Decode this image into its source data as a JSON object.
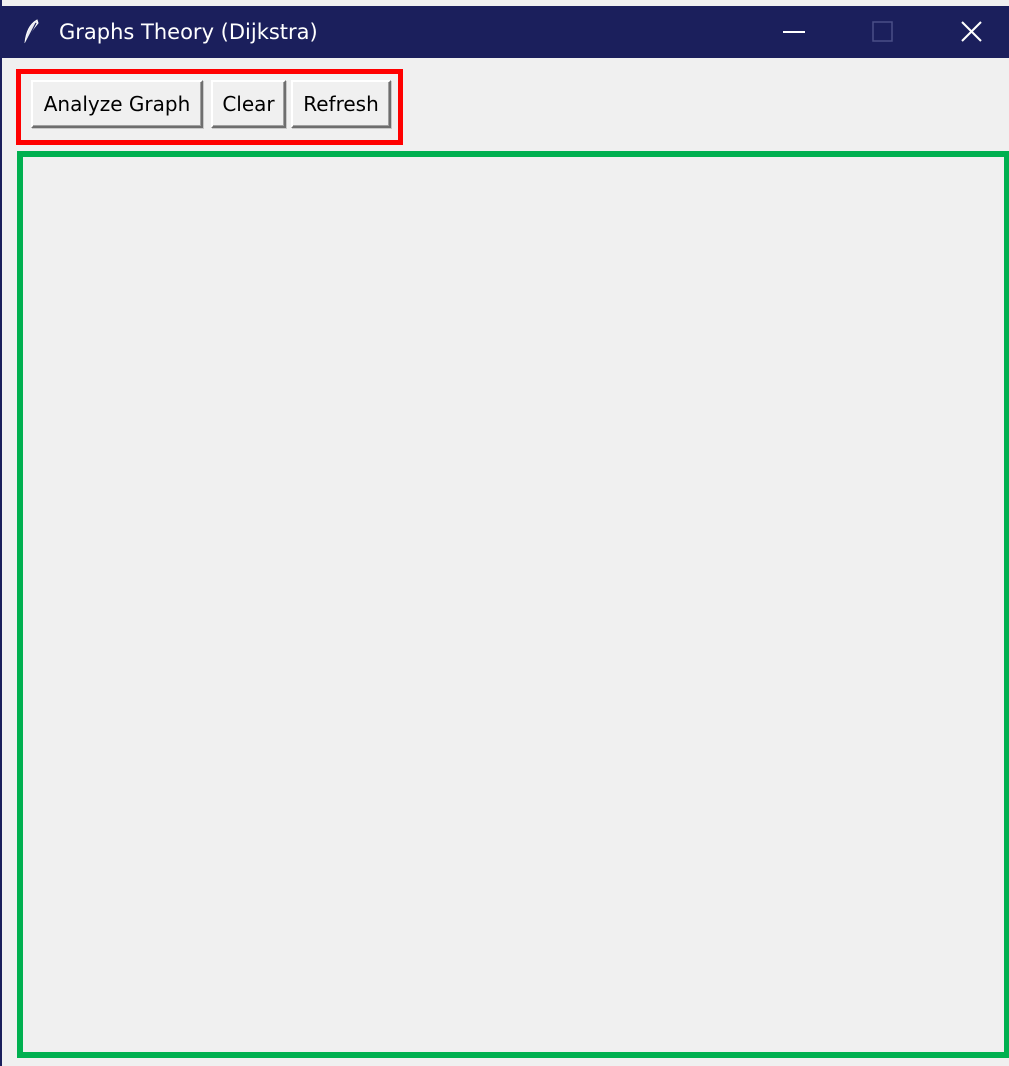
{
  "window": {
    "title": "Graphs Theory (Dijkstra)",
    "icon": "feather-icon",
    "controls": {
      "minimize_icon": "minimize-icon",
      "maximize_icon": "maximize-icon",
      "close_icon": "close-icon"
    }
  },
  "toolbar": {
    "analyze_label": "Analyze Graph",
    "clear_label": "Clear",
    "refresh_label": "Refresh"
  },
  "colors": {
    "titlebar": "#1b1f5c",
    "window_background": "#f0f0f0",
    "toolbar_highlight": "#ff0000",
    "canvas_highlight": "#00b050"
  }
}
